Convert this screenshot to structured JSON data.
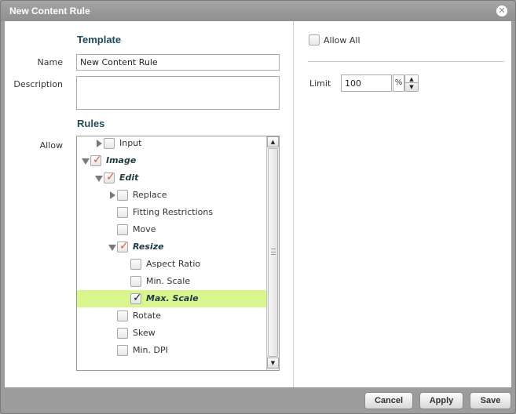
{
  "window": {
    "title": "New Content Rule",
    "close_icon": "close-icon"
  },
  "template": {
    "heading": "Template",
    "name_label": "Name",
    "name_value": "New Content Rule",
    "description_label": "Description",
    "description_value": ""
  },
  "rules": {
    "heading": "Rules",
    "allow_label": "Allow",
    "tree": [
      {
        "label": "Input",
        "expander": "collapsed",
        "checked": false,
        "style": "normal",
        "level": 1
      },
      {
        "label": "Image",
        "expander": "expanded",
        "checked": true,
        "check_color": "red",
        "style": "bold-italic",
        "level": 0
      },
      {
        "label": "Edit",
        "expander": "expanded",
        "checked": true,
        "check_color": "red",
        "style": "bold-italic",
        "level": 1
      },
      {
        "label": "Replace",
        "expander": "collapsed",
        "checked": false,
        "style": "normal",
        "level": 2
      },
      {
        "label": "Fitting Restrictions",
        "expander": "none",
        "checked": false,
        "style": "normal",
        "level": 2
      },
      {
        "label": "Move",
        "expander": "none",
        "checked": false,
        "style": "normal",
        "level": 2
      },
      {
        "label": "Resize",
        "expander": "expanded",
        "checked": true,
        "check_color": "red",
        "style": "bold-italic",
        "level": 2
      },
      {
        "label": "Aspect Ratio",
        "expander": "none",
        "checked": false,
        "style": "normal",
        "level": 3
      },
      {
        "label": "Min. Scale",
        "expander": "none",
        "checked": false,
        "style": "normal",
        "level": 3
      },
      {
        "label": "Max. Scale",
        "expander": "none",
        "checked": true,
        "check_color": "black",
        "style": "bold-italic",
        "level": 3,
        "selected": true
      },
      {
        "label": "Rotate",
        "expander": "none",
        "checked": false,
        "style": "normal",
        "level": 2
      },
      {
        "label": "Skew",
        "expander": "none",
        "checked": false,
        "style": "normal",
        "level": 2
      },
      {
        "label": "Min. DPI",
        "expander": "none",
        "checked": false,
        "style": "normal",
        "level": 2
      }
    ]
  },
  "right_panel": {
    "allow_all_label": "Allow All",
    "allow_all_checked": false,
    "limit_label": "Limit",
    "limit_value": "100",
    "limit_unit": "%"
  },
  "footer": {
    "cancel_label": "Cancel",
    "apply_label": "Apply",
    "save_label": "Save"
  },
  "colors": {
    "accent_heading": "#1f4c5c",
    "selected_row": "#d9f58e",
    "partial_check": "#e05a2a"
  }
}
